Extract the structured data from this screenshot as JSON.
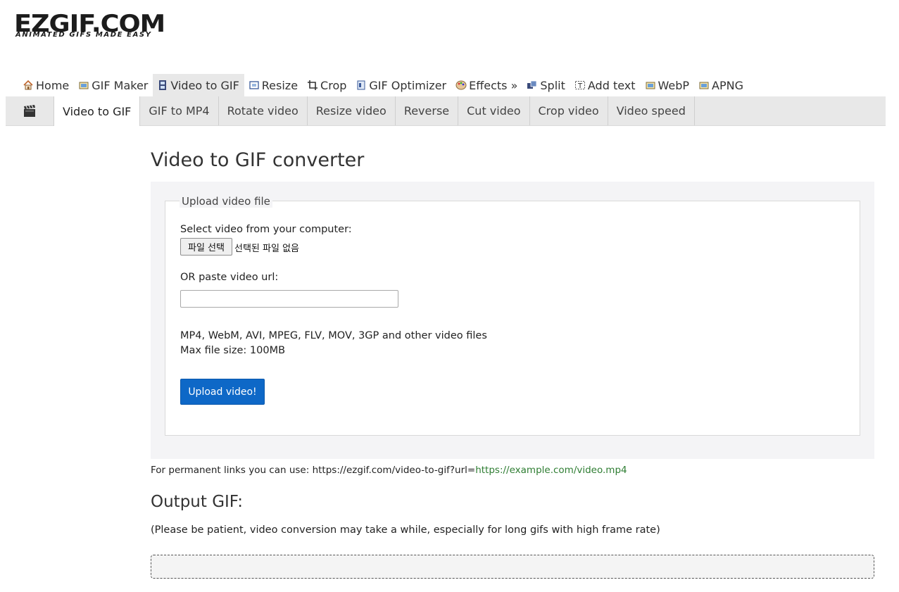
{
  "logo": {
    "main": "EZGIF.COM",
    "tagline": "ANIMATED GIFS MADE EASY"
  },
  "main_nav": [
    {
      "label": "Home",
      "icon": "home-icon"
    },
    {
      "label": "GIF Maker",
      "icon": "gif-maker-icon"
    },
    {
      "label": "Video to GIF",
      "icon": "film-icon",
      "active": true
    },
    {
      "label": "Resize",
      "icon": "resize-icon"
    },
    {
      "label": "Crop",
      "icon": "crop-icon"
    },
    {
      "label": "GIF Optimizer",
      "icon": "optimizer-icon"
    },
    {
      "label": "Effects »",
      "icon": "palette-icon"
    },
    {
      "label": "Split",
      "icon": "split-icon"
    },
    {
      "label": "Add text",
      "icon": "text-icon"
    },
    {
      "label": "WebP",
      "icon": "webp-icon"
    },
    {
      "label": "APNG",
      "icon": "apng-icon"
    }
  ],
  "sub_nav": {
    "icon": "clapperboard-icon",
    "items": [
      {
        "label": "Video to GIF",
        "active": true
      },
      {
        "label": "GIF to MP4"
      },
      {
        "label": "Rotate video"
      },
      {
        "label": "Resize video"
      },
      {
        "label": "Reverse"
      },
      {
        "label": "Cut video"
      },
      {
        "label": "Crop video"
      },
      {
        "label": "Video speed"
      }
    ]
  },
  "page_title": "Video to GIF converter",
  "upload": {
    "legend": "Upload video file",
    "select_label": "Select video from your computer:",
    "file_button": "파일 선택",
    "file_status": "선택된 파일 없음",
    "url_label": "OR paste video url:",
    "url_value": "",
    "formats": "MP4, WebM, AVI, MPEG, FLV, MOV, 3GP and other video files",
    "max_size": "Max file size: 100MB",
    "submit": "Upload video!"
  },
  "permanent": {
    "prefix": "For permanent links you can use: https://ezgif.com/video-to-gif?url=",
    "example_url": "https://example.com/video.mp4"
  },
  "output": {
    "title": "Output GIF:",
    "note": "(Please be patient, video conversion may take a while, especially for long gifs with high frame rate)"
  },
  "colors": {
    "primary_button": "#0e68c7",
    "link_green": "#2e7d32",
    "nav_bar": "#e8e8e8"
  }
}
